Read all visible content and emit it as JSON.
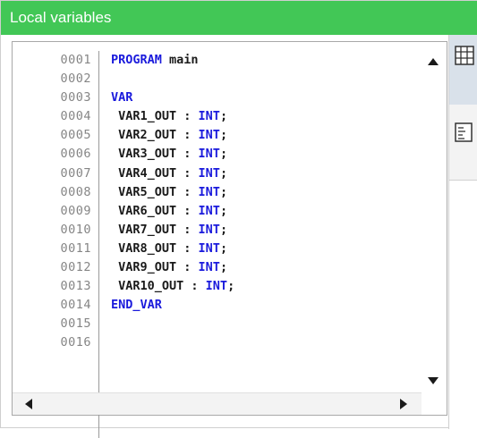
{
  "window": {
    "title": "Local variables"
  },
  "editor": {
    "lines": [
      {
        "num": "0001",
        "kw1": "PROGRAM",
        "text": " main",
        "kw2": "",
        "tail": ""
      },
      {
        "num": "0002",
        "kw1": "",
        "text": "",
        "kw2": "",
        "tail": ""
      },
      {
        "num": "0003",
        "kw1": "VAR",
        "text": "",
        "kw2": "",
        "tail": ""
      },
      {
        "num": "0004",
        "kw1": "",
        "text": " VAR1_OUT : ",
        "kw2": "INT",
        "tail": ";"
      },
      {
        "num": "0005",
        "kw1": "",
        "text": " VAR2_OUT : ",
        "kw2": "INT",
        "tail": ";"
      },
      {
        "num": "0006",
        "kw1": "",
        "text": " VAR3_OUT : ",
        "kw2": "INT",
        "tail": ";"
      },
      {
        "num": "0007",
        "kw1": "",
        "text": " VAR4_OUT : ",
        "kw2": "INT",
        "tail": ";"
      },
      {
        "num": "0008",
        "kw1": "",
        "text": " VAR5_OUT : ",
        "kw2": "INT",
        "tail": ";"
      },
      {
        "num": "0009",
        "kw1": "",
        "text": " VAR6_OUT : ",
        "kw2": "INT",
        "tail": ";"
      },
      {
        "num": "0010",
        "kw1": "",
        "text": " VAR7_OUT : ",
        "kw2": "INT",
        "tail": ";"
      },
      {
        "num": "0011",
        "kw1": "",
        "text": " VAR8_OUT : ",
        "kw2": "INT",
        "tail": ";"
      },
      {
        "num": "0012",
        "kw1": "",
        "text": " VAR9_OUT : ",
        "kw2": "INT",
        "tail": ";"
      },
      {
        "num": "0013",
        "kw1": "",
        "text": " VAR10_OUT : ",
        "kw2": "INT",
        "tail": ";"
      },
      {
        "num": "0014",
        "kw1": "END_VAR",
        "text": "",
        "kw2": "",
        "tail": ""
      },
      {
        "num": "0015",
        "kw1": "",
        "text": "",
        "kw2": "",
        "tail": ""
      },
      {
        "num": "0016",
        "kw1": "",
        "text": "",
        "kw2": "",
        "tail": ""
      }
    ]
  },
  "scrollbars": {
    "vertical": {
      "up_icon": "arrow-up-icon",
      "down_icon": "arrow-down-icon"
    },
    "horizontal": {
      "left_icon": "arrow-left-icon",
      "right_icon": "arrow-right-icon"
    }
  },
  "right_panel": {
    "tabs": [
      {
        "icon": "table-grid-icon"
      },
      {
        "icon": "text-list-icon"
      }
    ]
  },
  "colors": {
    "titlebar": "#42c756",
    "keyword": "#1a1adc",
    "line_number": "#858585"
  }
}
